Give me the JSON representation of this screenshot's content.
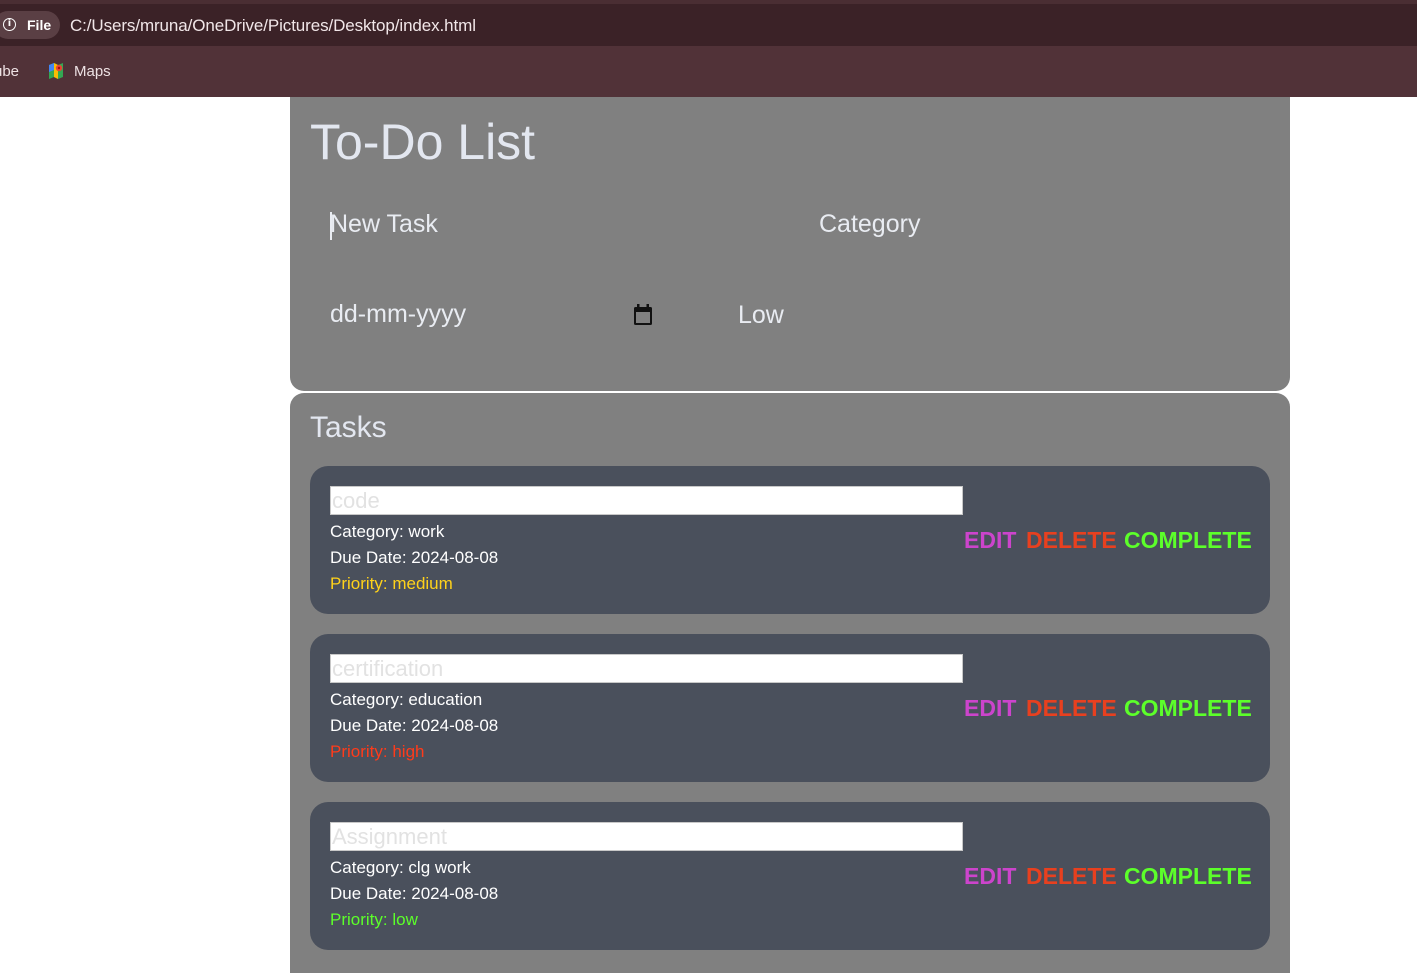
{
  "browser": {
    "file_label": "File",
    "url": "C:/Users/mruna/OneDrive/Pictures/Desktop/index.html",
    "bookmarks": [
      "ube",
      "Maps"
    ]
  },
  "app": {
    "title": "To-Do List",
    "task_placeholder": "New Task",
    "category_placeholder": "Category",
    "date_placeholder": "dd-mm-yyyy",
    "priority_value": "Low",
    "tasks_heading": "Tasks"
  },
  "tasks": [
    {
      "name": "code",
      "category": "Category: work",
      "due": "Due Date: 2024-08-08",
      "priority": "Priority: medium",
      "priority_color": "#ffd21a"
    },
    {
      "name": "certification",
      "category": "Category: education",
      "due": "Due Date: 2024-08-08",
      "priority": "Priority: high",
      "priority_color": "#ff3b1a"
    },
    {
      "name": "Assignment",
      "category": "Category: clg work",
      "due": "Due Date: 2024-08-08",
      "priority": "Priority: low",
      "priority_color": "#5cff2a"
    }
  ],
  "actions": {
    "edit": "EDIT",
    "delete": "DELETE",
    "complete": "COMPLETE"
  },
  "colors": {
    "panel_bg": "#808080",
    "card_bg": "#4a505c",
    "edit": "#cc44cc",
    "delete": "#e8401f",
    "complete": "#5cff2a"
  }
}
